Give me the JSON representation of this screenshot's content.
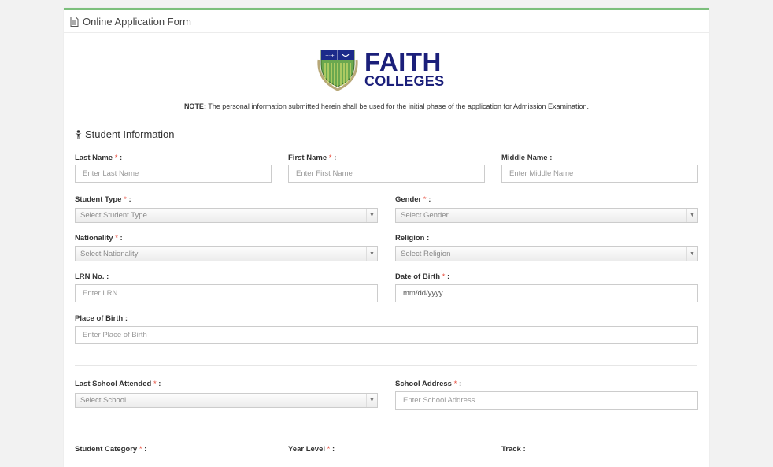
{
  "panel": {
    "title": "Online Application Form"
  },
  "logo": {
    "line1": "FAITH",
    "line2": "COLLEGES"
  },
  "note": {
    "label": "NOTE:",
    "text": "The personal information submitted herein shall be used for the initial phase of the application for Admission Examination."
  },
  "section": {
    "title": "Student Information"
  },
  "fields": {
    "last_name": {
      "label": "Last Name",
      "required": "*",
      "suffix": ":",
      "placeholder": "Enter Last Name"
    },
    "first_name": {
      "label": "First Name",
      "required": "*",
      "suffix": ":",
      "placeholder": "Enter First Name"
    },
    "middle_name": {
      "label": "Middle Name :",
      "placeholder": "Enter Middle Name"
    },
    "student_type": {
      "label": "Student Type",
      "required": "*",
      "suffix": ":",
      "value": "Select Student Type"
    },
    "gender": {
      "label": "Gender",
      "required": "*",
      "suffix": ":",
      "value": "Select Gender"
    },
    "nationality": {
      "label": "Nationality",
      "required": "*",
      "suffix": ":",
      "value": "Select Nationality"
    },
    "religion": {
      "label": "Religion :",
      "value": "Select Religion"
    },
    "lrn": {
      "label": "LRN No. :",
      "placeholder": "Enter LRN"
    },
    "dob": {
      "label": "Date of Birth",
      "required": "*",
      "suffix": ":",
      "value": "mm/dd/yyyy"
    },
    "place_of_birth": {
      "label": "Place of Birth :",
      "placeholder": "Enter Place of Birth"
    },
    "last_school": {
      "label": "Last School Attended",
      "required": "*",
      "suffix": ":",
      "value": "Select School"
    },
    "school_address": {
      "label": "School Address",
      "required": "*",
      "suffix": ":",
      "placeholder": "Enter School Address"
    },
    "student_category": {
      "label": "Student Category",
      "required": "*",
      "suffix": ":"
    },
    "year_level": {
      "label": "Year Level",
      "required": "*",
      "suffix": ":"
    },
    "track": {
      "label": "Track :"
    }
  },
  "icons": {
    "panel": "document-icon",
    "section": "person-icon",
    "dropdown": "dropdown-arrow-icon"
  },
  "colors": {
    "accent": "#7cbf7c",
    "brand": "#1b1f7a",
    "required": "#e74c3c"
  }
}
